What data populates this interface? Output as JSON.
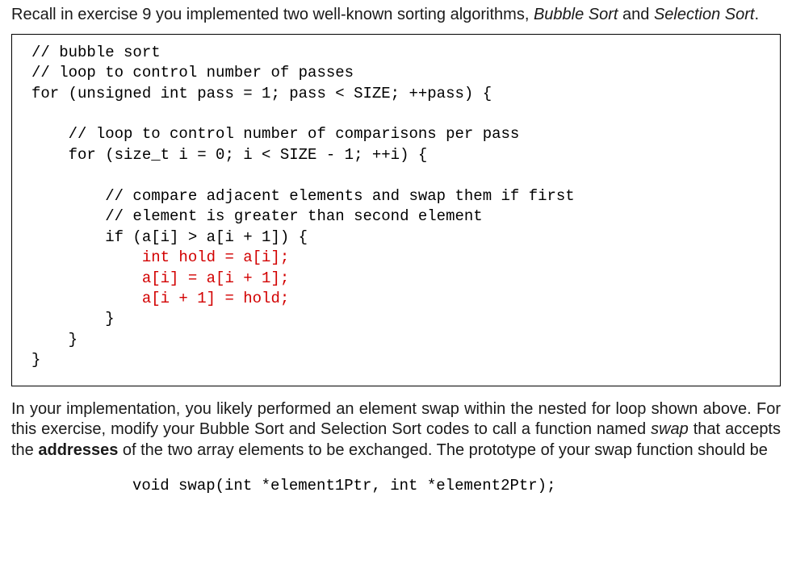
{
  "intro": {
    "s1": "Recall in exercise 9 you implemented two well-known sorting algorithms, ",
    "em1": "Bubble Sort",
    "s2": " and ",
    "em2": "Selection Sort",
    "s3": "."
  },
  "code": {
    "l1": "// bubble sort",
    "l2": "// loop to control number of passes",
    "l3": "for (unsigned int pass = 1; pass < SIZE; ++pass) {",
    "l4": "",
    "l5": "    // loop to control number of comparisons per pass",
    "l6": "    for (size_t i = 0; i < SIZE - 1; ++i) {",
    "l7": "",
    "l8": "        // compare adjacent elements and swap them if first",
    "l9": "        // element is greater than second element",
    "l10": "        if (a[i] > a[i + 1]) {",
    "r1": "            int hold = a[i];",
    "r2": "            a[i] = a[i + 1];",
    "r3": "            a[i + 1] = hold;",
    "l11": "        }",
    "l12": "    }",
    "l13": "}"
  },
  "para2": {
    "s1": "In your implementation, you likely performed an element swap within the nested for loop shown above.  For this exercise, modify your Bubble Sort and Selection Sort codes to call a function named ",
    "em1": "swap",
    "s2": " that accepts the ",
    "bold1": "addresses",
    "s3": " of the two array elements to be exchanged.  The prototype of your swap function should be"
  },
  "prototype": "void swap(int *element1Ptr, int *element2Ptr);"
}
